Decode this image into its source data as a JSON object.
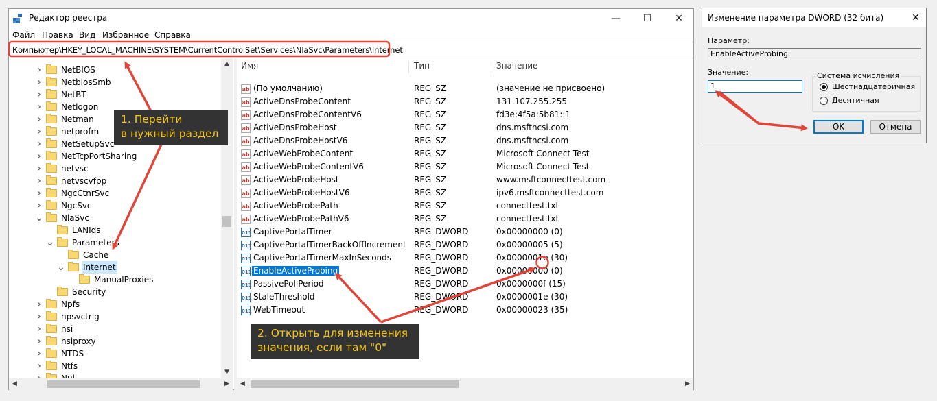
{
  "window": {
    "title": "Редактор реестра",
    "minimize": "—",
    "maximize": "☐",
    "close": "✕"
  },
  "menu": [
    "Файл",
    "Правка",
    "Вид",
    "Избранное",
    "Справка"
  ],
  "address": "Компьютер\\HKEY_LOCAL_MACHINE\\SYSTEM\\CurrentControlSet\\Services\\NlaSvc\\Parameters\\Internet",
  "tree": [
    {
      "label": "NetBIOS",
      "indent": 0,
      "toggle": ">"
    },
    {
      "label": "NetbiosSmb",
      "indent": 0,
      "toggle": ">"
    },
    {
      "label": "NetBT",
      "indent": 0,
      "toggle": ">"
    },
    {
      "label": "Netlogon",
      "indent": 0,
      "toggle": ">"
    },
    {
      "label": "Netman",
      "indent": 0,
      "toggle": ">"
    },
    {
      "label": "netprofm",
      "indent": 0,
      "toggle": ">"
    },
    {
      "label": "NetSetupSvc",
      "indent": 0,
      "toggle": ">"
    },
    {
      "label": "NetTcpPortSharing",
      "indent": 0,
      "toggle": ">"
    },
    {
      "label": "netvsc",
      "indent": 0,
      "toggle": ">"
    },
    {
      "label": "netvscvfpp",
      "indent": 0,
      "toggle": ">"
    },
    {
      "label": "NgcCtnrSvc",
      "indent": 0,
      "toggle": ">"
    },
    {
      "label": "NgcSvc",
      "indent": 0,
      "toggle": ">"
    },
    {
      "label": "NlaSvc",
      "indent": 0,
      "toggle": "v"
    },
    {
      "label": "LANIds",
      "indent": 1,
      "toggle": ""
    },
    {
      "label": "Parameters",
      "indent": 1,
      "toggle": "v"
    },
    {
      "label": "Cache",
      "indent": 2,
      "toggle": ""
    },
    {
      "label": "Internet",
      "indent": 2,
      "toggle": "v",
      "selected": true
    },
    {
      "label": "ManualProxies",
      "indent": 3,
      "toggle": ""
    },
    {
      "label": "Security",
      "indent": 1,
      "toggle": ""
    },
    {
      "label": "Npfs",
      "indent": 0,
      "toggle": ">"
    },
    {
      "label": "npsvctrig",
      "indent": 0,
      "toggle": ">"
    },
    {
      "label": "nsi",
      "indent": 0,
      "toggle": ">"
    },
    {
      "label": "nsiproxy",
      "indent": 0,
      "toggle": ">"
    },
    {
      "label": "NTDS",
      "indent": 0,
      "toggle": ">"
    },
    {
      "label": "Ntfs",
      "indent": 0,
      "toggle": ">"
    },
    {
      "label": "Null",
      "indent": 0,
      "toggle": ">"
    }
  ],
  "columns": {
    "name": "Имя",
    "type": "Тип",
    "value": "Значение"
  },
  "values": [
    {
      "icon": "sz",
      "name": "(По умолчанию)",
      "type": "REG_SZ",
      "value": "(значение не присвоено)"
    },
    {
      "icon": "sz",
      "name": "ActiveDnsProbeContent",
      "type": "REG_SZ",
      "value": "131.107.255.255"
    },
    {
      "icon": "sz",
      "name": "ActiveDnsProbeContentV6",
      "type": "REG_SZ",
      "value": "fd3e:4f5a:5b81::1"
    },
    {
      "icon": "sz",
      "name": "ActiveDnsProbeHost",
      "type": "REG_SZ",
      "value": "dns.msftncsi.com"
    },
    {
      "icon": "sz",
      "name": "ActiveDnsProbeHostV6",
      "type": "REG_SZ",
      "value": "dns.msftncsi.com"
    },
    {
      "icon": "sz",
      "name": "ActiveWebProbeContent",
      "type": "REG_SZ",
      "value": "Microsoft Connect Test"
    },
    {
      "icon": "sz",
      "name": "ActiveWebProbeContentV6",
      "type": "REG_SZ",
      "value": "Microsoft Connect Test"
    },
    {
      "icon": "sz",
      "name": "ActiveWebProbeHost",
      "type": "REG_SZ",
      "value": "www.msftconnecttest.com"
    },
    {
      "icon": "sz",
      "name": "ActiveWebProbeHostV6",
      "type": "REG_SZ",
      "value": "ipv6.msftconnecttest.com"
    },
    {
      "icon": "sz",
      "name": "ActiveWebProbePath",
      "type": "REG_SZ",
      "value": "connecttest.txt"
    },
    {
      "icon": "sz",
      "name": "ActiveWebProbePathV6",
      "type": "REG_SZ",
      "value": "connecttest.txt"
    },
    {
      "icon": "dw",
      "name": "CaptivePortalTimer",
      "type": "REG_DWORD",
      "value": "0x00000000 (0)"
    },
    {
      "icon": "dw",
      "name": "CaptivePortalTimerBackOffIncrementsIn...",
      "type": "REG_DWORD",
      "value": "0x00000005 (5)"
    },
    {
      "icon": "dw",
      "name": "CaptivePortalTimerMaxInSeconds",
      "type": "REG_DWORD",
      "value": "0x0000001e (30)"
    },
    {
      "icon": "dw",
      "name": "EnableActiveProbing",
      "type": "REG_DWORD",
      "value": "0x00000000 (0)",
      "selected": true
    },
    {
      "icon": "dw",
      "name": "PassivePollPeriod",
      "type": "REG_DWORD",
      "value": "0x0000000f (15)"
    },
    {
      "icon": "dw",
      "name": "StaleThreshold",
      "type": "REG_DWORD",
      "value": "0x0000001e (30)"
    },
    {
      "icon": "dw",
      "name": "WebTimeout",
      "type": "REG_DWORD",
      "value": "0x00000023 (35)"
    }
  ],
  "icons": {
    "sz": "ab",
    "dw": "011"
  },
  "dialog": {
    "title": "Изменение параметра DWORD (32 бита)",
    "close": "✕",
    "param_label": "Параметр:",
    "param_value": "EnableActiveProbing",
    "value_label": "Значение:",
    "value": "1",
    "base_group": "Система исчисления",
    "base_hex": "Шестнадцатеричная",
    "base_dec": "Десятичная",
    "ok": "OK",
    "cancel": "Отмена"
  },
  "annotations": {
    "step1_line1": "1. Перейти",
    "step1_line2": "в нужный раздел",
    "step2_line1": "2. Открыть для изменения",
    "step2_line2": "значения, если там \"0\""
  },
  "colors": {
    "annotation": "#e0453a",
    "selection": "#0078d7",
    "callout_text": "#f5c518"
  }
}
